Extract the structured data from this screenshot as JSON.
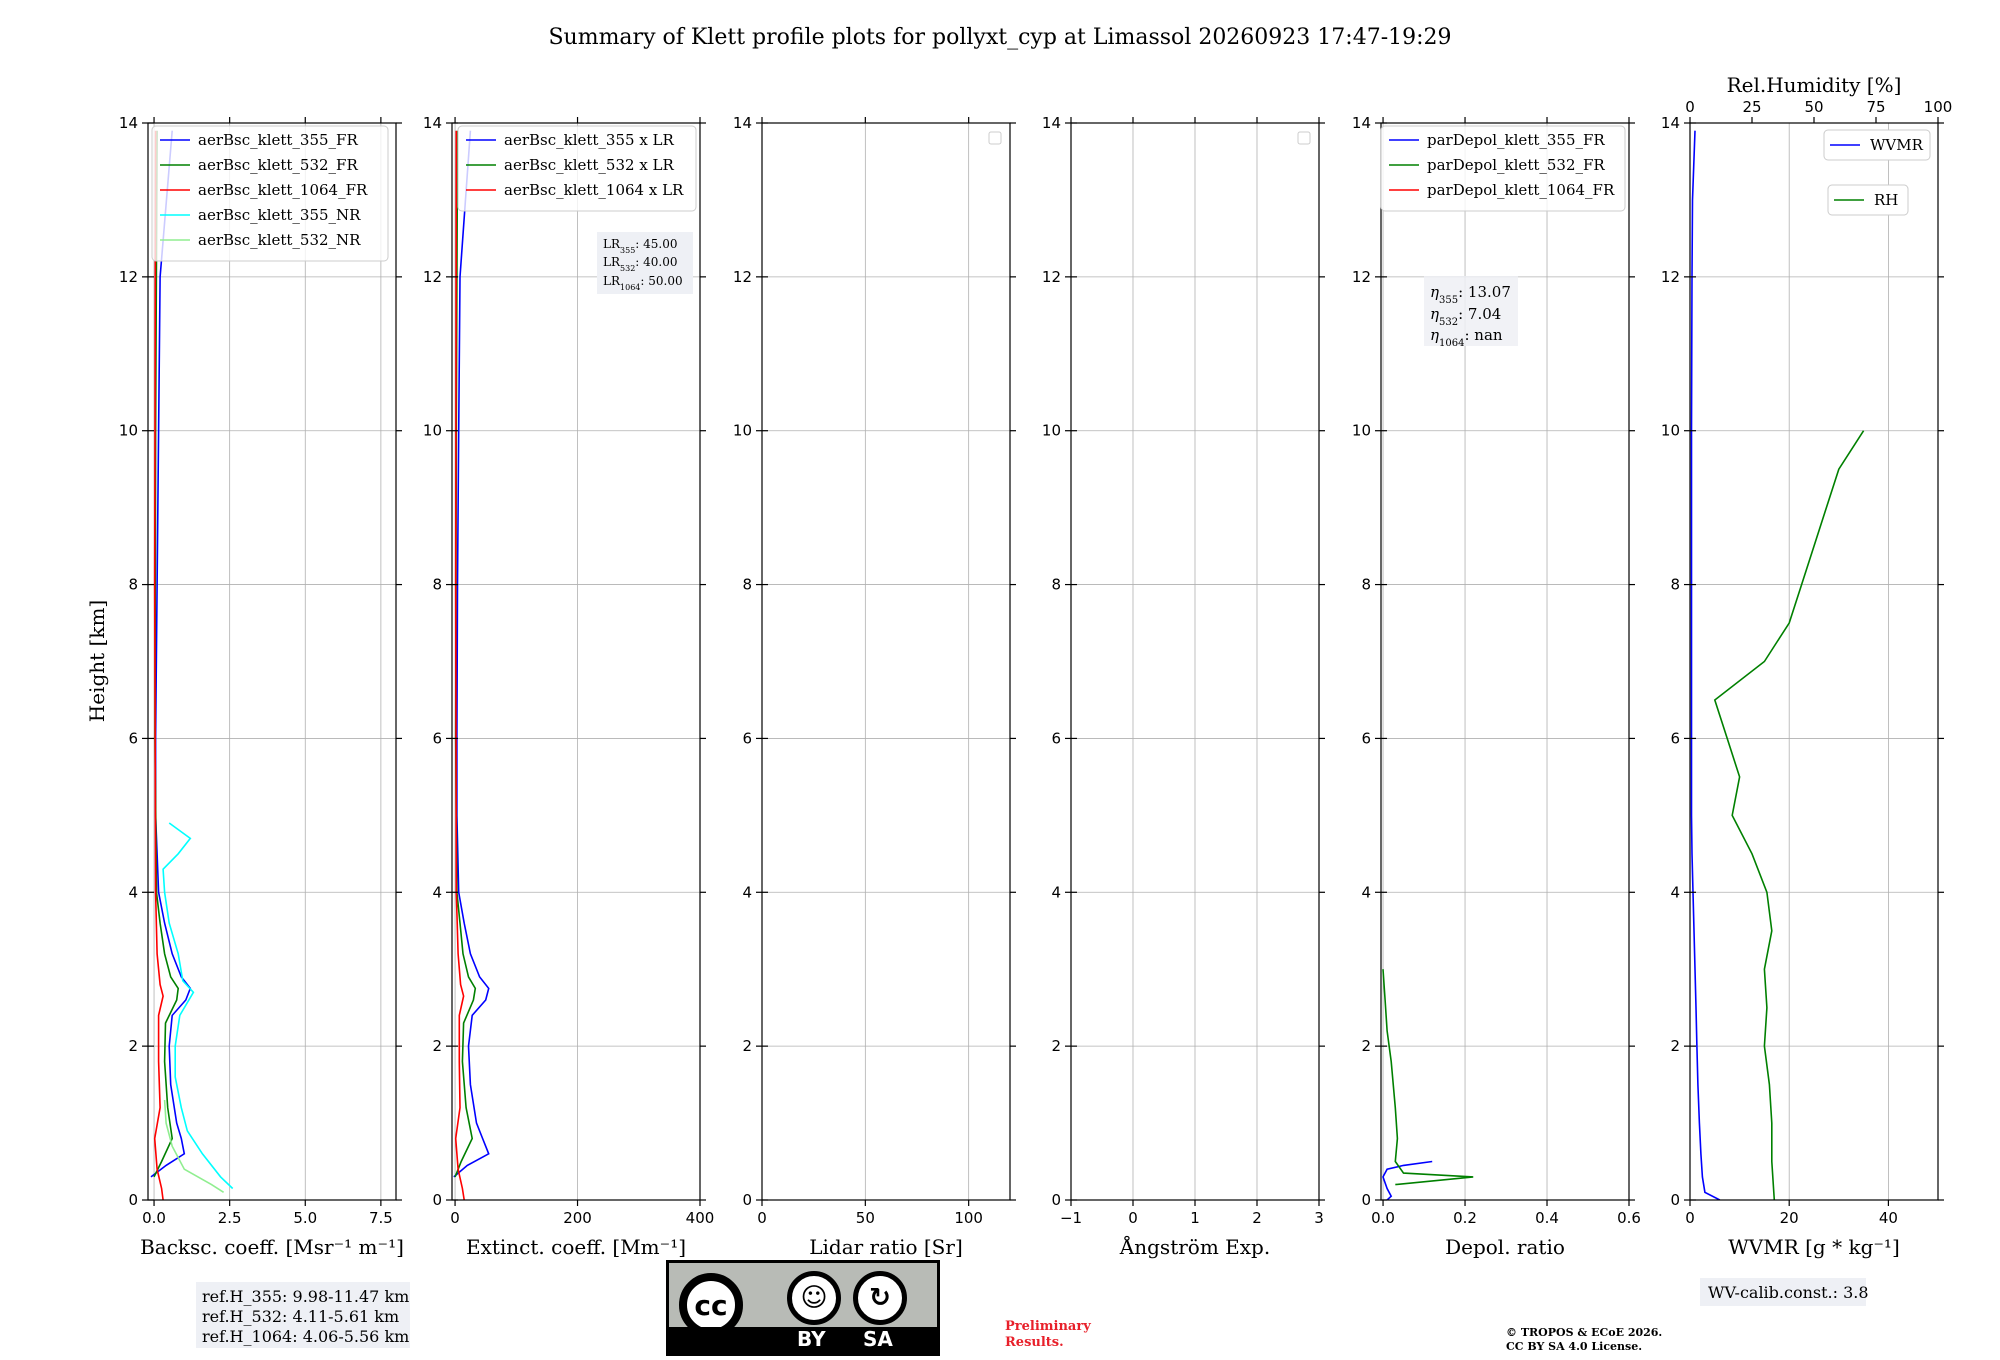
{
  "title": "Summary of Klett profile plots for pollyxt_cyp at Limassol 20260923 17:47-19:29",
  "ylabel": "Height [km]",
  "colors": {
    "c355": "#0000ff",
    "c532": "#008000",
    "c1064": "#ff0000",
    "c355nr": "#00ffff",
    "c532nr": "#90ee90"
  },
  "notes": {
    "refh_355": "ref.H_355: 9.98-11.47 km",
    "refh_532": "ref.H_532: 4.11-5.61 km",
    "refh_1064": "ref.H_1064: 4.06-5.56 km",
    "wv_calib": "WV-calib.const.: 3.8",
    "preliminary_line1": "Preliminary",
    "preliminary_line2": "Results.",
    "copyright_line1": "© TROPOS & ECoE 2026.",
    "copyright_line2": "CC BY SA 4.0 License.",
    "cc_logo": "cc-by-sa-logo",
    "cc_by": "BY",
    "cc_sa": "SA"
  },
  "chart_data": [
    {
      "id": "backscatter",
      "type": "line",
      "xlabel": "Backsc. coeff. [Msr⁻¹ m⁻¹]",
      "xlim": [
        -0.2,
        8.0
      ],
      "xticks": [
        0.0,
        2.5,
        5.0,
        7.5
      ],
      "xtick_labels": [
        "0.0",
        "2.5",
        "5.0",
        "7.5"
      ],
      "ylim": [
        0,
        14
      ],
      "yticks": [
        0,
        2,
        4,
        6,
        8,
        10,
        12,
        14
      ],
      "grid": true,
      "legend_placement": "top-right",
      "series": [
        {
          "name": "aerBsc_klett_355_FR",
          "color": "#0000ff",
          "y": [
            0.3,
            0.45,
            0.6,
            0.8,
            1.0,
            1.5,
            2.0,
            2.4,
            2.6,
            2.75,
            2.9,
            3.2,
            3.6,
            4.0,
            5.0,
            6.0,
            8.0,
            10.0,
            12.0,
            13.9
          ],
          "x": [
            -0.1,
            0.4,
            1.0,
            0.9,
            0.75,
            0.55,
            0.5,
            0.6,
            1.05,
            1.2,
            0.9,
            0.6,
            0.35,
            0.15,
            0.05,
            0.05,
            0.1,
            0.15,
            0.2,
            0.6
          ]
        },
        {
          "name": "aerBsc_klett_532_FR",
          "color": "#008000",
          "y": [
            0.3,
            0.5,
            0.8,
            1.2,
            1.8,
            2.3,
            2.6,
            2.75,
            2.9,
            3.2,
            3.6,
            4.0,
            6.0,
            10.0,
            13.9
          ],
          "x": [
            0.0,
            0.25,
            0.6,
            0.45,
            0.35,
            0.38,
            0.75,
            0.8,
            0.55,
            0.35,
            0.2,
            0.08,
            0.03,
            0.05,
            0.1
          ]
        },
        {
          "name": "aerBsc_klett_1064_FR",
          "color": "#ff0000",
          "y": [
            0.0,
            0.15,
            0.4,
            0.8,
            1.2,
            1.8,
            2.4,
            2.65,
            2.8,
            3.2,
            4.0,
            8.0,
            13.9
          ],
          "x": [
            0.3,
            0.25,
            0.1,
            0.02,
            0.2,
            0.15,
            0.15,
            0.3,
            0.2,
            0.1,
            0.05,
            0.02,
            0.05
          ]
        },
        {
          "name": "aerBsc_klett_355_NR",
          "color": "#00ffff",
          "y": [
            0.15,
            0.3,
            0.6,
            0.9,
            1.2,
            1.6,
            2.0,
            2.4,
            2.7,
            2.85,
            3.2,
            3.6,
            4.0,
            4.3,
            4.5,
            4.7,
            4.9
          ],
          "x": [
            2.6,
            2.2,
            1.6,
            1.1,
            0.9,
            0.7,
            0.7,
            0.85,
            1.3,
            0.95,
            0.8,
            0.5,
            0.35,
            0.3,
            0.8,
            1.2,
            0.5
          ]
        },
        {
          "name": "aerBsc_klett_532_NR",
          "color": "#90ee90",
          "y": [
            0.1,
            0.2,
            0.4,
            0.7,
            1.0,
            1.3
          ],
          "x": [
            2.3,
            1.9,
            1.0,
            0.6,
            0.4,
            0.35
          ]
        }
      ]
    },
    {
      "id": "extinction",
      "type": "line",
      "xlabel": "Extinct. coeff. [Mm⁻¹]",
      "xlim": [
        -5,
        400
      ],
      "xticks": [
        0,
        200,
        400
      ],
      "xtick_labels": [
        "0",
        "200",
        "400"
      ],
      "ylim": [
        0,
        14
      ],
      "yticks": [
        0,
        2,
        4,
        6,
        8,
        10,
        12,
        14
      ],
      "grid": true,
      "legend_placement": "top-right",
      "annotation": {
        "lr355": "45.00",
        "lr532": "40.00",
        "lr1064": "50.00"
      },
      "series": [
        {
          "name": "aerBsc_klett_355 x LR",
          "color": "#0000ff",
          "y": [
            0.3,
            0.45,
            0.6,
            0.8,
            1.0,
            1.5,
            2.0,
            2.4,
            2.6,
            2.75,
            2.9,
            3.2,
            3.6,
            4.0,
            5.0,
            6.0,
            8.0,
            10.0,
            12.0,
            13.9
          ],
          "x": [
            -2,
            20,
            55,
            45,
            35,
            25,
            22,
            28,
            50,
            55,
            40,
            25,
            15,
            6,
            3,
            3,
            4,
            6,
            8,
            25
          ]
        },
        {
          "name": "aerBsc_klett_532 x LR",
          "color": "#008000",
          "y": [
            0.3,
            0.5,
            0.8,
            1.2,
            1.8,
            2.3,
            2.6,
            2.75,
            2.9,
            3.2,
            3.6,
            4.0,
            6.0,
            10.0,
            13.9
          ],
          "x": [
            0,
            10,
            28,
            18,
            12,
            14,
            30,
            33,
            22,
            13,
            8,
            3,
            1,
            2,
            4
          ]
        },
        {
          "name": "aerBsc_klett_1064 x LR",
          "color": "#ff0000",
          "y": [
            0.0,
            0.15,
            0.4,
            0.8,
            1.2,
            1.8,
            2.4,
            2.65,
            2.8,
            3.2,
            4.0,
            8.0,
            13.9
          ],
          "x": [
            15,
            12,
            5,
            1,
            8,
            7,
            7,
            14,
            9,
            5,
            2,
            1,
            2
          ]
        }
      ]
    },
    {
      "id": "lidar_ratio",
      "type": "line",
      "xlabel": "Lidar ratio [Sr]",
      "xlim": [
        0,
        120
      ],
      "xticks": [
        0,
        50,
        100
      ],
      "xtick_labels": [
        "0",
        "50",
        "100"
      ],
      "ylim": [
        0,
        14
      ],
      "yticks": [
        0,
        2,
        4,
        6,
        8,
        10,
        12,
        14
      ],
      "grid": true,
      "legend_placement": "top-right",
      "series": []
    },
    {
      "id": "angstrom",
      "type": "line",
      "xlabel": "Ångström Exp.",
      "xlim": [
        -1,
        3
      ],
      "xticks": [
        -1,
        0,
        1,
        2,
        3
      ],
      "xtick_labels": [
        "−1",
        "0",
        "1",
        "2",
        "3"
      ],
      "ylim": [
        0,
        14
      ],
      "yticks": [
        0,
        2,
        4,
        6,
        8,
        10,
        12,
        14
      ],
      "grid": true,
      "legend_placement": "top-right",
      "series": []
    },
    {
      "id": "depol",
      "type": "line",
      "xlabel": "Depol. ratio",
      "xlim": [
        -0.005,
        0.6
      ],
      "xticks": [
        0.0,
        0.2,
        0.4,
        0.6
      ],
      "xtick_labels": [
        "0.0",
        "0.2",
        "0.4",
        "0.6"
      ],
      "ylim": [
        0,
        14
      ],
      "yticks": [
        0,
        2,
        4,
        6,
        8,
        10,
        12,
        14
      ],
      "grid": true,
      "legend_placement": "top-right",
      "annotation": {
        "eta355": "13.07",
        "eta532": "7.04",
        "eta1064": "nan"
      },
      "series": [
        {
          "name": "parDepol_klett_355_FR",
          "color": "#0000ff",
          "y": [
            0.0,
            0.05,
            0.15,
            0.3,
            0.4,
            0.45,
            0.5
          ],
          "x": [
            0.01,
            0.02,
            0.01,
            0.0,
            0.01,
            0.05,
            0.12
          ]
        },
        {
          "name": "parDepol_klett_532_FR",
          "color": "#008000",
          "y": [
            0.2,
            0.3,
            0.35,
            0.5,
            0.8,
            1.2,
            1.8,
            2.2,
            2.6,
            3.0
          ],
          "x": [
            0.03,
            0.22,
            0.05,
            0.03,
            0.035,
            0.03,
            0.02,
            0.01,
            0.005,
            0.0
          ]
        },
        {
          "name": "parDepol_klett_1064_FR",
          "color": "#ff0000",
          "y": [],
          "x": []
        }
      ]
    },
    {
      "id": "wvmr",
      "type": "line",
      "xlabel": "WVMR [g * kg⁻¹]",
      "xlim": [
        0,
        50
      ],
      "xticks": [
        0,
        20,
        40
      ],
      "xtick_labels": [
        "0",
        "20",
        "40"
      ],
      "top_xlabel": "Rel.Humidity [%]",
      "top_xlim": [
        0,
        100
      ],
      "top_xticks": [
        0,
        25,
        50,
        75,
        100
      ],
      "top_xtick_labels": [
        "0",
        "25",
        "50",
        "75",
        "100"
      ],
      "ylim": [
        0,
        14
      ],
      "yticks": [
        0,
        2,
        4,
        6,
        8,
        10,
        12,
        14
      ],
      "grid": true,
      "legend_placement": "top-right",
      "series": [
        {
          "name": "WVMR",
          "color": "#0000ff",
          "axis": "bottom",
          "y": [
            0.0,
            0.1,
            0.3,
            0.6,
            1.0,
            1.5,
            2.0,
            2.5,
            3.0,
            3.5,
            4.0,
            4.5,
            5.0,
            6.0,
            8.0,
            10.0,
            12.0,
            13.0,
            13.9
          ],
          "x": [
            6,
            3,
            2.5,
            2.2,
            1.9,
            1.6,
            1.4,
            1.2,
            1.0,
            0.8,
            0.6,
            0.4,
            0.3,
            0.3,
            0.3,
            0.3,
            0.4,
            0.5,
            1.0
          ]
        },
        {
          "name": "RH",
          "color": "#008000",
          "axis": "top",
          "y": [
            0.0,
            0.5,
            1.0,
            1.5,
            2.0,
            2.5,
            3.0,
            3.5,
            4.0,
            4.5,
            5.0,
            5.5,
            6.0,
            6.5,
            7.0,
            7.5,
            8.0,
            8.5,
            9.0,
            9.5,
            10.0
          ],
          "x": [
            34,
            33,
            33,
            32,
            30,
            31,
            30,
            33,
            31,
            25,
            17,
            20,
            15,
            10,
            30,
            40,
            45,
            50,
            55,
            60,
            70
          ]
        }
      ]
    }
  ]
}
